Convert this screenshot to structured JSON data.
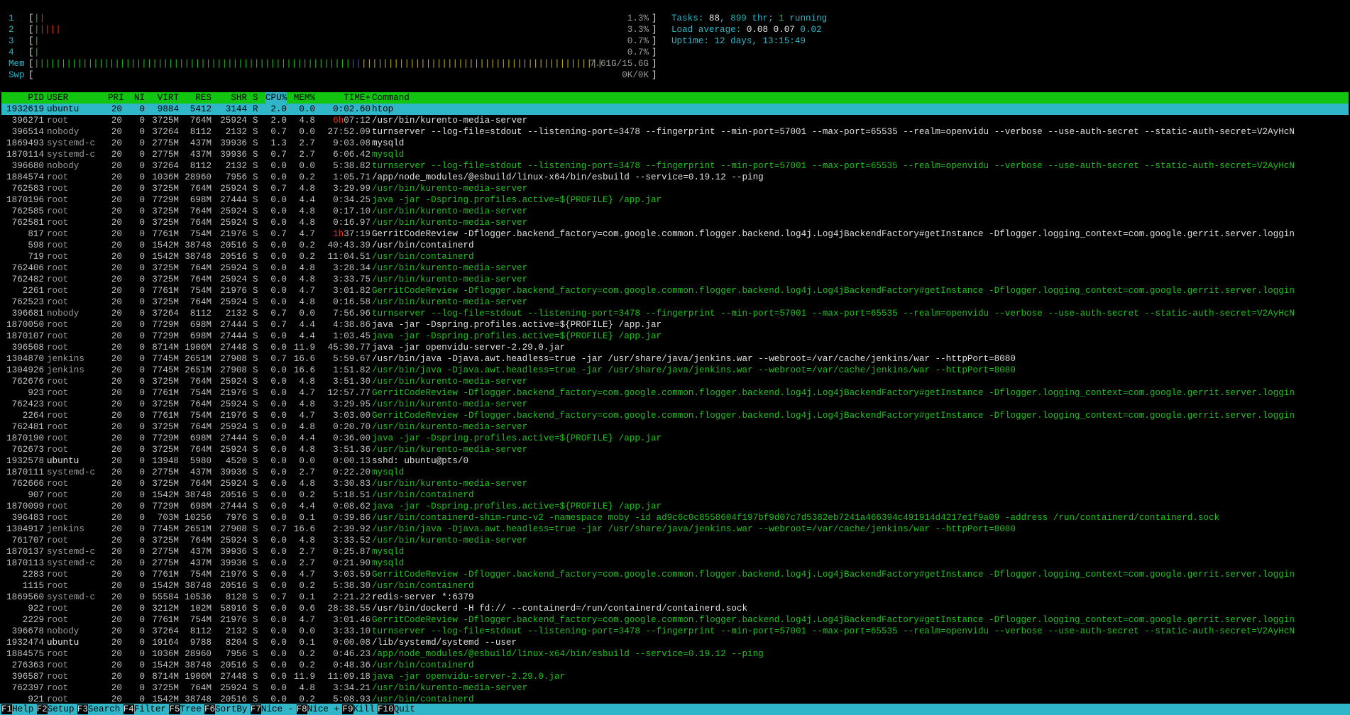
{
  "cpu_meters": [
    {
      "label": "1",
      "value": "1.3%",
      "bar": [
        {
          "c": "g",
          "t": "|"
        },
        {
          "c": "r",
          "t": "|"
        }
      ]
    },
    {
      "label": "2",
      "value": "3.3%",
      "bar": [
        {
          "c": "g",
          "t": "|"
        },
        {
          "c": "r",
          "t": "||||"
        }
      ]
    },
    {
      "label": "3",
      "value": "0.7%",
      "bar": [
        {
          "c": "g",
          "t": "|"
        }
      ]
    },
    {
      "label": "4",
      "value": "0.7%",
      "bar": [
        {
          "c": "g",
          "t": "|"
        }
      ]
    }
  ],
  "mem_meter": {
    "label": "Mem",
    "value": "7.61G/15.6G"
  },
  "swp_meter": {
    "label": "Swp",
    "value": "0K/0K"
  },
  "stats": {
    "tasks_label": "Tasks: ",
    "tasks": "88",
    "thr": "899",
    "running": "1",
    "load_label": "Load average: ",
    "load1": "0.08",
    "load5": "0.07",
    "load15": "0.02",
    "uptime_label": "Uptime: ",
    "uptime": "12 days, 13:15:49"
  },
  "columns": [
    "PID",
    "USER",
    "PRI",
    "NI",
    "VIRT",
    "RES",
    "SHR",
    "S",
    "CPU%",
    "MEM%",
    "TIME+",
    "Command"
  ],
  "processes": [
    [
      "1932619",
      "ubuntu",
      "20",
      "0",
      "9884",
      "5412",
      "3144",
      "R",
      "2.0",
      "0.0",
      "0:02.60",
      "htop",
      "sel"
    ],
    [
      "396271",
      "root",
      "20",
      "0",
      "3725M",
      "764M",
      "25924",
      "S",
      "2.0",
      "4.8",
      "6h07:12",
      "/usr/bin/kurento-media-server",
      "p"
    ],
    [
      "396514",
      "nobody",
      "20",
      "0",
      "37264",
      "8112",
      "2132",
      "S",
      "0.7",
      "0.0",
      "27:52.09",
      "turnserver --log-file=stdout --listening-port=3478 --fingerprint --min-port=57001 --max-port=65535 --realm=openvidu --verbose --use-auth-secret --static-auth-secret=V2AyHcN",
      "p"
    ],
    [
      "1869493",
      "systemd-c",
      "20",
      "0",
      "2775M",
      "437M",
      "39936",
      "S",
      "1.3",
      "2.7",
      "9:03.08",
      "mysqld",
      "p"
    ],
    [
      "1870114",
      "systemd-c",
      "20",
      "0",
      "2775M",
      "437M",
      "39936",
      "S",
      "0.7",
      "2.7",
      "6:06.42",
      "mysqld",
      "t"
    ],
    [
      "396680",
      "nobody",
      "20",
      "0",
      "37264",
      "8112",
      "2132",
      "S",
      "0.0",
      "0.0",
      "5:38.82",
      "turnserver --log-file=stdout --listening-port=3478 --fingerprint --min-port=57001 --max-port=65535 --realm=openvidu --verbose --use-auth-secret --static-auth-secret=V2AyHcN",
      "t"
    ],
    [
      "1884574",
      "root",
      "20",
      "0",
      "1036M",
      "28960",
      "7956",
      "S",
      "0.0",
      "0.2",
      "1:05.71",
      "/app/node_modules/@esbuild/linux-x64/bin/esbuild --service=0.19.12 --ping",
      "p"
    ],
    [
      "762583",
      "root",
      "20",
      "0",
      "3725M",
      "764M",
      "25924",
      "S",
      "0.7",
      "4.8",
      "3:29.99",
      "/usr/bin/kurento-media-server",
      "t"
    ],
    [
      "1870196",
      "root",
      "20",
      "0",
      "7729M",
      "698M",
      "27444",
      "S",
      "0.0",
      "4.4",
      "0:34.25",
      "java -jar -Dspring.profiles.active=${PROFILE} /app.jar",
      "t"
    ],
    [
      "762585",
      "root",
      "20",
      "0",
      "3725M",
      "764M",
      "25924",
      "S",
      "0.0",
      "4.8",
      "0:17.10",
      "/usr/bin/kurento-media-server",
      "t"
    ],
    [
      "762581",
      "root",
      "20",
      "0",
      "3725M",
      "764M",
      "25924",
      "S",
      "0.0",
      "4.8",
      "0:16.97",
      "/usr/bin/kurento-media-server",
      "t"
    ],
    [
      "817",
      "root",
      "20",
      "0",
      "7761M",
      "754M",
      "21976",
      "S",
      "0.7",
      "4.7",
      "1h37:19",
      "GerritCodeReview -Dflogger.backend_factory=com.google.common.flogger.backend.log4j.Log4jBackendFactory#getInstance -Dflogger.logging_context=com.google.gerrit.server.loggin",
      "p"
    ],
    [
      "598",
      "root",
      "20",
      "0",
      "1542M",
      "38748",
      "20516",
      "S",
      "0.0",
      "0.2",
      "40:43.39",
      "/usr/bin/containerd",
      "p"
    ],
    [
      "719",
      "root",
      "20",
      "0",
      "1542M",
      "38748",
      "20516",
      "S",
      "0.0",
      "0.2",
      "11:04.51",
      "/usr/bin/containerd",
      "t"
    ],
    [
      "762406",
      "root",
      "20",
      "0",
      "3725M",
      "764M",
      "25924",
      "S",
      "0.0",
      "4.8",
      "3:28.34",
      "/usr/bin/kurento-media-server",
      "t"
    ],
    [
      "762482",
      "root",
      "20",
      "0",
      "3725M",
      "764M",
      "25924",
      "S",
      "0.0",
      "4.8",
      "3:33.75",
      "/usr/bin/kurento-media-server",
      "t"
    ],
    [
      "2261",
      "root",
      "20",
      "0",
      "7761M",
      "754M",
      "21976",
      "S",
      "0.0",
      "4.7",
      "3:01.82",
      "GerritCodeReview -Dflogger.backend_factory=com.google.common.flogger.backend.log4j.Log4jBackendFactory#getInstance -Dflogger.logging_context=com.google.gerrit.server.loggin",
      "t"
    ],
    [
      "762523",
      "root",
      "20",
      "0",
      "3725M",
      "764M",
      "25924",
      "S",
      "0.0",
      "4.8",
      "0:16.58",
      "/usr/bin/kurento-media-server",
      "t"
    ],
    [
      "396681",
      "nobody",
      "20",
      "0",
      "37264",
      "8112",
      "2132",
      "S",
      "0.7",
      "0.0",
      "7:56.96",
      "turnserver --log-file=stdout --listening-port=3478 --fingerprint --min-port=57001 --max-port=65535 --realm=openvidu --verbose --use-auth-secret --static-auth-secret=V2AyHcN",
      "t"
    ],
    [
      "1870050",
      "root",
      "20",
      "0",
      "7729M",
      "698M",
      "27444",
      "S",
      "0.7",
      "4.4",
      "4:38.86",
      "java -jar -Dspring.profiles.active=${PROFILE} /app.jar",
      "p"
    ],
    [
      "1870107",
      "root",
      "20",
      "0",
      "7729M",
      "698M",
      "27444",
      "S",
      "0.0",
      "4.4",
      "1:03.45",
      "java -jar -Dspring.profiles.active=${PROFILE} /app.jar",
      "t"
    ],
    [
      "396508",
      "root",
      "20",
      "0",
      "8714M",
      "1906M",
      "27448",
      "S",
      "0.0",
      "11.9",
      "45:30.77",
      "java -jar openvidu-server-2.29.0.jar",
      "p"
    ],
    [
      "1304870",
      "jenkins",
      "20",
      "0",
      "7745M",
      "2651M",
      "27908",
      "S",
      "0.7",
      "16.6",
      "5:59.67",
      "/usr/bin/java -Djava.awt.headless=true -jar /usr/share/java/jenkins.war --webroot=/var/cache/jenkins/war --httpPort=8080",
      "p"
    ],
    [
      "1304926",
      "jenkins",
      "20",
      "0",
      "7745M",
      "2651M",
      "27908",
      "S",
      "0.0",
      "16.6",
      "1:51.82",
      "/usr/bin/java -Djava.awt.headless=true -jar /usr/share/java/jenkins.war --webroot=/var/cache/jenkins/war --httpPort=8080",
      "t"
    ],
    [
      "762676",
      "root",
      "20",
      "0",
      "3725M",
      "764M",
      "25924",
      "S",
      "0.0",
      "4.8",
      "3:51.30",
      "/usr/bin/kurento-media-server",
      "t"
    ],
    [
      "923",
      "root",
      "20",
      "0",
      "7761M",
      "754M",
      "21976",
      "S",
      "0.0",
      "4.7",
      "12:57.77",
      "GerritCodeReview -Dflogger.backend_factory=com.google.common.flogger.backend.log4j.Log4jBackendFactory#getInstance -Dflogger.logging_context=com.google.gerrit.server.loggin",
      "t"
    ],
    [
      "762423",
      "root",
      "20",
      "0",
      "3725M",
      "764M",
      "25924",
      "S",
      "0.0",
      "4.8",
      "3:29.95",
      "/usr/bin/kurento-media-server",
      "t"
    ],
    [
      "2264",
      "root",
      "20",
      "0",
      "7761M",
      "754M",
      "21976",
      "S",
      "0.0",
      "4.7",
      "3:03.00",
      "GerritCodeReview -Dflogger.backend_factory=com.google.common.flogger.backend.log4j.Log4jBackendFactory#getInstance -Dflogger.logging_context=com.google.gerrit.server.loggin",
      "t"
    ],
    [
      "762481",
      "root",
      "20",
      "0",
      "3725M",
      "764M",
      "25924",
      "S",
      "0.0",
      "4.8",
      "0:20.70",
      "/usr/bin/kurento-media-server",
      "t"
    ],
    [
      "1870190",
      "root",
      "20",
      "0",
      "7729M",
      "698M",
      "27444",
      "S",
      "0.0",
      "4.4",
      "0:36.00",
      "java -jar -Dspring.profiles.active=${PROFILE} /app.jar",
      "t"
    ],
    [
      "762673",
      "root",
      "20",
      "0",
      "3725M",
      "764M",
      "25924",
      "S",
      "0.0",
      "4.8",
      "3:51.36",
      "/usr/bin/kurento-media-server",
      "t"
    ],
    [
      "1932578",
      "ubuntu",
      "20",
      "0",
      "13948",
      "5980",
      "4520",
      "S",
      "0.0",
      "0.0",
      "0:00.13",
      "sshd: ubuntu@pts/0",
      "p"
    ],
    [
      "1870111",
      "systemd-c",
      "20",
      "0",
      "2775M",
      "437M",
      "39936",
      "S",
      "0.0",
      "2.7",
      "0:22.20",
      "mysqld",
      "t"
    ],
    [
      "762666",
      "root",
      "20",
      "0",
      "3725M",
      "764M",
      "25924",
      "S",
      "0.0",
      "4.8",
      "3:30.83",
      "/usr/bin/kurento-media-server",
      "t"
    ],
    [
      "907",
      "root",
      "20",
      "0",
      "1542M",
      "38748",
      "20516",
      "S",
      "0.0",
      "0.2",
      "5:18.51",
      "/usr/bin/containerd",
      "t"
    ],
    [
      "1870099",
      "root",
      "20",
      "0",
      "7729M",
      "698M",
      "27444",
      "S",
      "0.0",
      "4.4",
      "0:08.62",
      "java -jar -Dspring.profiles.active=${PROFILE} /app.jar",
      "t"
    ],
    [
      "396483",
      "root",
      "20",
      "0",
      "703M",
      "10256",
      "7976",
      "S",
      "0.0",
      "0.1",
      "0:39.86",
      "/usr/bin/containerd-shim-runc-v2 -namespace moby -id ad9c6c0c8558604f197bf9d07c7d5382eb7241a466394c491914d4217e1f9a09 -address /run/containerd/containerd.sock",
      "t"
    ],
    [
      "1304917",
      "jenkins",
      "20",
      "0",
      "7745M",
      "2651M",
      "27908",
      "S",
      "0.7",
      "16.6",
      "2:39.92",
      "/usr/bin/java -Djava.awt.headless=true -jar /usr/share/java/jenkins.war --webroot=/var/cache/jenkins/war --httpPort=8080",
      "t"
    ],
    [
      "761707",
      "root",
      "20",
      "0",
      "3725M",
      "764M",
      "25924",
      "S",
      "0.0",
      "4.8",
      "3:33.52",
      "/usr/bin/kurento-media-server",
      "t"
    ],
    [
      "1870137",
      "systemd-c",
      "20",
      "0",
      "2775M",
      "437M",
      "39936",
      "S",
      "0.0",
      "2.7",
      "0:25.87",
      "mysqld",
      "t"
    ],
    [
      "1870113",
      "systemd-c",
      "20",
      "0",
      "2775M",
      "437M",
      "39936",
      "S",
      "0.0",
      "2.7",
      "0:21.90",
      "mysqld",
      "t"
    ],
    [
      "2283",
      "root",
      "20",
      "0",
      "7761M",
      "754M",
      "21976",
      "S",
      "0.0",
      "4.7",
      "3:03.59",
      "GerritCodeReview -Dflogger.backend_factory=com.google.common.flogger.backend.log4j.Log4jBackendFactory#getInstance -Dflogger.logging_context=com.google.gerrit.server.loggin",
      "t"
    ],
    [
      "1115",
      "root",
      "20",
      "0",
      "1542M",
      "38748",
      "20516",
      "S",
      "0.0",
      "0.2",
      "5:38.30",
      "/usr/bin/containerd",
      "t"
    ],
    [
      "1869560",
      "systemd-c",
      "20",
      "0",
      "55584",
      "10536",
      "8128",
      "S",
      "0.7",
      "0.1",
      "2:21.22",
      "redis-server *:6379",
      "p"
    ],
    [
      "922",
      "root",
      "20",
      "0",
      "3212M",
      "102M",
      "58916",
      "S",
      "0.0",
      "0.6",
      "28:38.55",
      "/usr/bin/dockerd -H fd:// --containerd=/run/containerd/containerd.sock",
      "p"
    ],
    [
      "2229",
      "root",
      "20",
      "0",
      "7761M",
      "754M",
      "21976",
      "S",
      "0.0",
      "4.7",
      "3:01.46",
      "GerritCodeReview -Dflogger.backend_factory=com.google.common.flogger.backend.log4j.Log4jBackendFactory#getInstance -Dflogger.logging_context=com.google.gerrit.server.loggin",
      "t"
    ],
    [
      "396678",
      "nobody",
      "20",
      "0",
      "37264",
      "8112",
      "2132",
      "S",
      "0.0",
      "0.0",
      "3:33.10",
      "turnserver --log-file=stdout --listening-port=3478 --fingerprint --min-port=57001 --max-port=65535 --realm=openvidu --verbose --use-auth-secret --static-auth-secret=V2AyHcN",
      "t"
    ],
    [
      "1932474",
      "ubuntu",
      "20",
      "0",
      "19164",
      "9788",
      "8204",
      "S",
      "0.0",
      "0.1",
      "0:00.08",
      "/lib/systemd/systemd --user",
      "p"
    ],
    [
      "1884575",
      "root",
      "20",
      "0",
      "1036M",
      "28960",
      "7956",
      "S",
      "0.0",
      "0.2",
      "0:46.23",
      "/app/node_modules/@esbuild/linux-x64/bin/esbuild --service=0.19.12 --ping",
      "t"
    ],
    [
      "276363",
      "root",
      "20",
      "0",
      "1542M",
      "38748",
      "20516",
      "S",
      "0.0",
      "0.2",
      "0:48.36",
      "/usr/bin/containerd",
      "t"
    ],
    [
      "396587",
      "root",
      "20",
      "0",
      "8714M",
      "1906M",
      "27448",
      "S",
      "0.0",
      "11.9",
      "11:09.18",
      "java -jar openvidu-server-2.29.0.jar",
      "t"
    ],
    [
      "762397",
      "root",
      "20",
      "0",
      "3725M",
      "764M",
      "25924",
      "S",
      "0.0",
      "4.8",
      "3:34.21",
      "/usr/bin/kurento-media-server",
      "t"
    ],
    [
      "921",
      "root",
      "20",
      "0",
      "1542M",
      "38748",
      "20516",
      "S",
      "0.0",
      "0.2",
      "5:08.93",
      "/usr/bin/containerd",
      "t"
    ]
  ],
  "footer": [
    {
      "key": "F1",
      "label": "Help"
    },
    {
      "key": "F2",
      "label": "Setup"
    },
    {
      "key": "F3",
      "label": "Search"
    },
    {
      "key": "F4",
      "label": "Filter"
    },
    {
      "key": "F5",
      "label": "Tree"
    },
    {
      "key": "F6",
      "label": "SortBy"
    },
    {
      "key": "F7",
      "label": "Nice -"
    },
    {
      "key": "F8",
      "label": "Nice +"
    },
    {
      "key": "F9",
      "label": "Kill"
    },
    {
      "key": "F10",
      "label": "Quit"
    }
  ],
  "colors": {
    "header_bg": "#11c511",
    "selection_bg": "#2fb6c8",
    "thread_cmd": "#20c020"
  }
}
